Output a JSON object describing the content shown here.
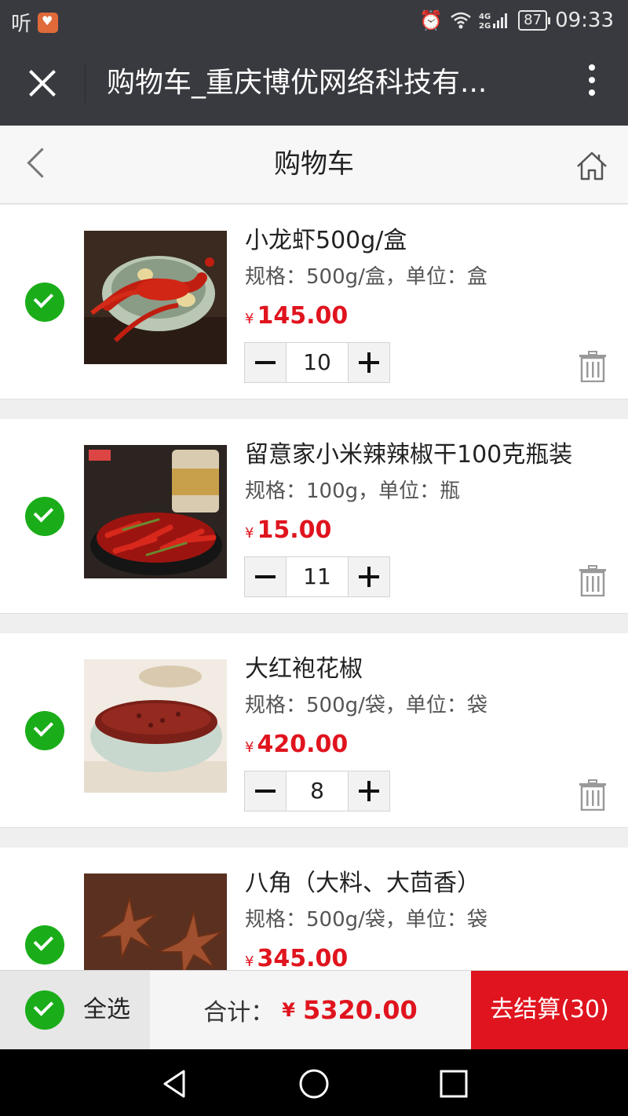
{
  "status_bar": {
    "left_app_label": "听",
    "battery": "87",
    "time": "09:33"
  },
  "titlebar": {
    "title": "购物车_重庆博优网络科技有..."
  },
  "header": {
    "title": "购物车"
  },
  "items": [
    {
      "name": "小龙虾500g/盒",
      "spec": "规格：500g/盒，单位：盒",
      "currency": "¥",
      "price": "145.00",
      "qty": "10"
    },
    {
      "name": "留意家小米辣辣椒干100克瓶装",
      "spec": "规格：100g，单位：瓶",
      "currency": "¥",
      "price": "15.00",
      "qty": "11"
    },
    {
      "name": "大红袍花椒",
      "spec": "规格：500g/袋，单位：袋",
      "currency": "¥",
      "price": "420.00",
      "qty": "8"
    },
    {
      "name": "八角（大料、大茴香）",
      "spec": "规格：500g/袋，单位：袋",
      "currency": "¥",
      "price": "345.00",
      "qty": ""
    }
  ],
  "footer": {
    "select_all": "全选",
    "total_label": "合计：",
    "total_currency": "¥",
    "total_amount": "5320.00",
    "checkout": "去结算(30)"
  },
  "colors": {
    "accent_green": "#1aad19",
    "price_red": "#e0141e",
    "titlebar_dark": "#393a3f"
  }
}
